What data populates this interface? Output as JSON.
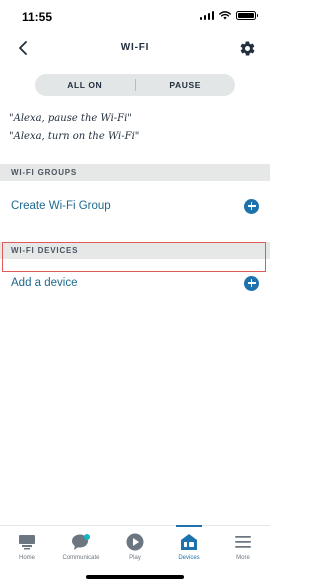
{
  "status_bar": {
    "time": "11:55"
  },
  "header": {
    "title": "WI-FI",
    "back_icon": "back-chevron-icon",
    "settings_icon": "gear-icon"
  },
  "segmented_control": {
    "all_on_label": "ALL ON",
    "pause_label": "PAUSE"
  },
  "phrases": [
    "\"Alexa, pause the Wi-Fi\"",
    "\"Alexa, turn on the Wi-Fi\""
  ],
  "groups_section": {
    "header": "WI-FI GROUPS",
    "action_label": "Create Wi-Fi Group",
    "action_icon": "plus-circle-icon"
  },
  "devices_section": {
    "header": "WI-FI DEVICES",
    "action_label": "Add a device",
    "action_icon": "plus-circle-icon"
  },
  "tab_bar": {
    "tabs": [
      {
        "label": "Home",
        "icon": "home-icon"
      },
      {
        "label": "Communicate",
        "icon": "chat-bubble-icon"
      },
      {
        "label": "Play",
        "icon": "play-icon"
      },
      {
        "label": "Devices",
        "icon": "devices-icon",
        "active": true
      },
      {
        "label": "More",
        "icon": "menu-icon"
      }
    ]
  },
  "colors": {
    "accent": "#1f73ad",
    "link": "#1e6a8f",
    "text": "#232f3e",
    "section_bg": "#e6e8e8",
    "highlight": "#e05a5a"
  }
}
